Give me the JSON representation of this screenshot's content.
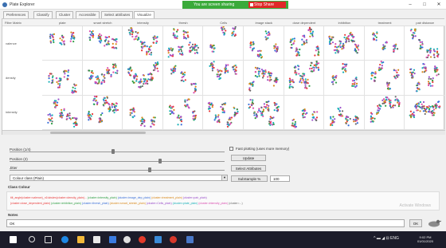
{
  "window": {
    "title": "Plate Explorer"
  },
  "share_banner": {
    "text": "You are screen sharing",
    "stop_label": "Stop Share",
    "color": "#3aaa3a"
  },
  "tabs": [
    {
      "label": "Preferences",
      "active": false
    },
    {
      "label": "Classify",
      "active": false
    },
    {
      "label": "Cluster",
      "active": false
    },
    {
      "label": "Accessible",
      "active": false
    },
    {
      "label": "Select attributes",
      "active": false
    },
    {
      "label": "Visualize",
      "active": true
    }
  ],
  "grid": {
    "filter_label": "Filter Matrix",
    "columns": [
      "plate",
      "smart stretch",
      "intensity",
      "thresh",
      "Cells",
      "image stack",
      "dose dependent",
      "inhibition",
      "treatment",
      "pair distance"
    ],
    "rows": [
      "valence",
      "density",
      "intensity"
    ]
  },
  "sliders": [
    {
      "label": "Position (1/4)",
      "value": 0.48
    },
    {
      "label": "Position (2)",
      "value": 0.7
    },
    {
      "label": "Jitter",
      "value": 0.65
    }
  ],
  "colour_select": {
    "value": "Colour class (Plain)"
  },
  "checkbox": {
    "label": "Fast plotting (uses more memory)",
    "checked": false
  },
  "buttons": {
    "update": "Update",
    "select_attributes": "Select Attributes",
    "subsample": "SubSample %"
  },
  "subsample_value": "100",
  "class_colour": {
    "title": "Class Colour",
    "lines": [
      "tilt_angle(cluster=valence)_n1tubules(cluster=density_plain)... (cluster=intensity_plain) (cluster=image_dep_plain) (cluster=treatment_plain) (cluster=pair_plain)",
      "(cluster=dose_dependent_plain) (cluster=inhibition_plain) (cluster=thresh_plain) (cluster=smart_stretch_plain) (cluster=Cells_plain) (cluster=plate_plain) (cluster=intensity_plain) (cluster=...)"
    ],
    "watermark": "Activate Windows"
  },
  "notes": {
    "title": "Notes",
    "value": "OK"
  },
  "ok_label": "OK",
  "tray": {
    "time": "9:02 PM",
    "date": "01/01/2020"
  },
  "colors": {
    "cluster": [
      "#e83a3a",
      "#2f9e44",
      "#3a6fd8",
      "#d98a1e",
      "#9a4fc9",
      "#1ab0b8",
      "#d94fb0",
      "#6b6b6b"
    ]
  }
}
